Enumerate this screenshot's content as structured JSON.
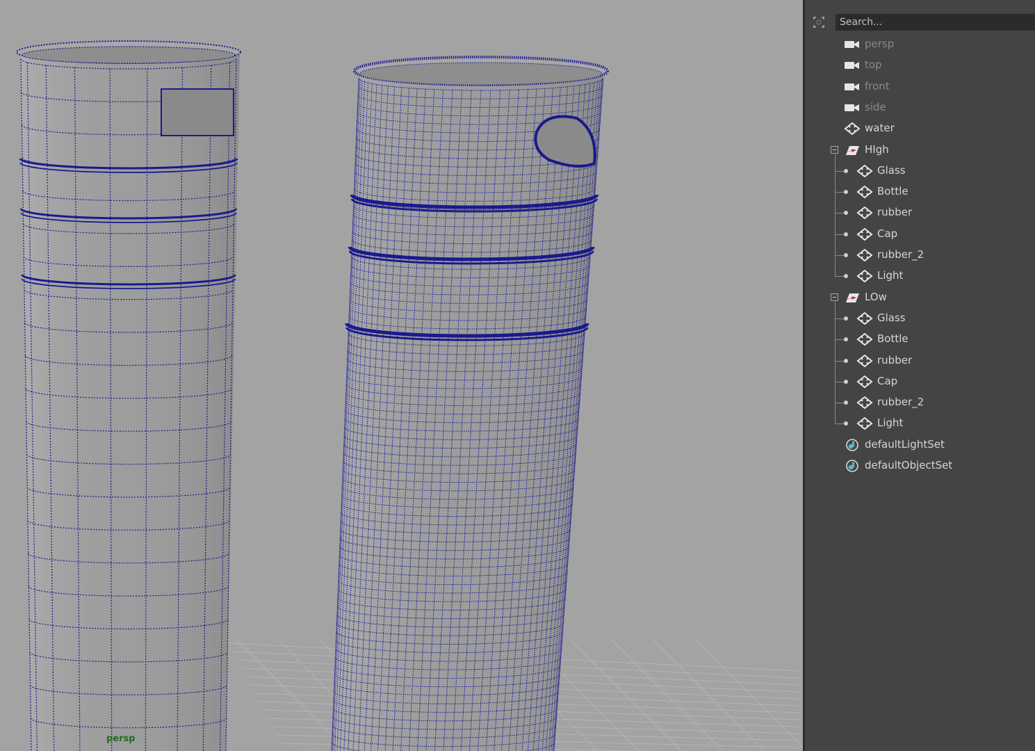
{
  "viewport": {
    "camera_label": "persp",
    "background": "#a3a3a3",
    "wire_color": "#1a1a8c"
  },
  "outliner": {
    "search": {
      "placeholder": "Search..."
    },
    "items": [
      {
        "label": "persp",
        "type": "camera",
        "icon": "camera-icon",
        "dim": true
      },
      {
        "label": "top",
        "type": "camera",
        "icon": "camera-icon",
        "dim": true
      },
      {
        "label": "front",
        "type": "camera",
        "icon": "camera-icon",
        "dim": true
      },
      {
        "label": "side",
        "type": "camera",
        "icon": "camera-icon",
        "dim": true
      },
      {
        "label": "water",
        "type": "mesh",
        "icon": "mesh-icon"
      },
      {
        "label": "HIgh",
        "type": "group",
        "icon": "group-icon",
        "expanded": true
      },
      {
        "label": "Glass",
        "type": "mesh",
        "icon": "mesh-icon",
        "parent": "HIgh"
      },
      {
        "label": "Bottle",
        "type": "mesh",
        "icon": "mesh-icon",
        "parent": "HIgh"
      },
      {
        "label": "rubber",
        "type": "mesh",
        "icon": "mesh-icon",
        "parent": "HIgh"
      },
      {
        "label": "Cap",
        "type": "mesh",
        "icon": "mesh-icon",
        "parent": "HIgh"
      },
      {
        "label": "rubber_2",
        "type": "mesh",
        "icon": "mesh-icon",
        "parent": "HIgh"
      },
      {
        "label": "Light",
        "type": "mesh",
        "icon": "mesh-icon",
        "parent": "HIgh"
      },
      {
        "label": "LOw",
        "type": "group",
        "icon": "group-icon",
        "expanded": true
      },
      {
        "label": "Glass",
        "type": "mesh",
        "icon": "mesh-icon",
        "parent": "LOw"
      },
      {
        "label": "Bottle",
        "type": "mesh",
        "icon": "mesh-icon",
        "parent": "LOw"
      },
      {
        "label": "rubber",
        "type": "mesh",
        "icon": "mesh-icon",
        "parent": "LOw"
      },
      {
        "label": "Cap",
        "type": "mesh",
        "icon": "mesh-icon",
        "parent": "LOw"
      },
      {
        "label": "rubber_2",
        "type": "mesh",
        "icon": "mesh-icon",
        "parent": "LOw"
      },
      {
        "label": "Light",
        "type": "mesh",
        "icon": "mesh-icon",
        "parent": "LOw"
      },
      {
        "label": "defaultLightSet",
        "type": "set",
        "icon": "set-icon"
      },
      {
        "label": "defaultObjectSet",
        "type": "set",
        "icon": "set-icon"
      }
    ]
  }
}
